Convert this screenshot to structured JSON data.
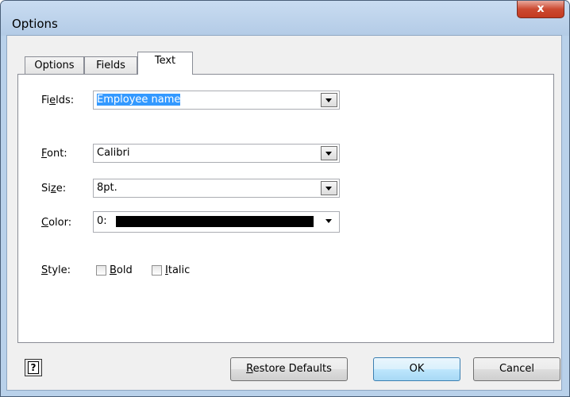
{
  "window": {
    "title": "Options",
    "close_symbol": "x"
  },
  "tabs": [
    {
      "label": "Options"
    },
    {
      "label": "Fields"
    },
    {
      "label": "Text",
      "active": true
    }
  ],
  "form": {
    "fields": {
      "label_pre": "Fi",
      "label_ul": "e",
      "label_post": "lds:",
      "value": "Employee name"
    },
    "font": {
      "label_pre": "",
      "label_ul": "F",
      "label_post": "ont:",
      "value": "Calibri"
    },
    "size": {
      "label_pre": "Si",
      "label_ul": "z",
      "label_post": "e:",
      "value": "8pt."
    },
    "color": {
      "label_pre": "",
      "label_ul": "C",
      "label_post": "olor:",
      "value": "0:",
      "swatch_color": "#000000"
    },
    "style": {
      "label_pre": "",
      "label_ul": "S",
      "label_post": "tyle:",
      "bold": {
        "label_ul": "B",
        "label_post": "old",
        "checked": false
      },
      "italic": {
        "label_ul": "I",
        "label_post": "talic",
        "checked": false
      }
    }
  },
  "buttons": {
    "restore_pre": "",
    "restore_ul": "R",
    "restore_post": "estore Defaults",
    "ok": "OK",
    "cancel": "Cancel",
    "help_symbol": "?"
  },
  "colors": {
    "selection": "#3399ff",
    "default_button_border": "#3c7fb1"
  }
}
